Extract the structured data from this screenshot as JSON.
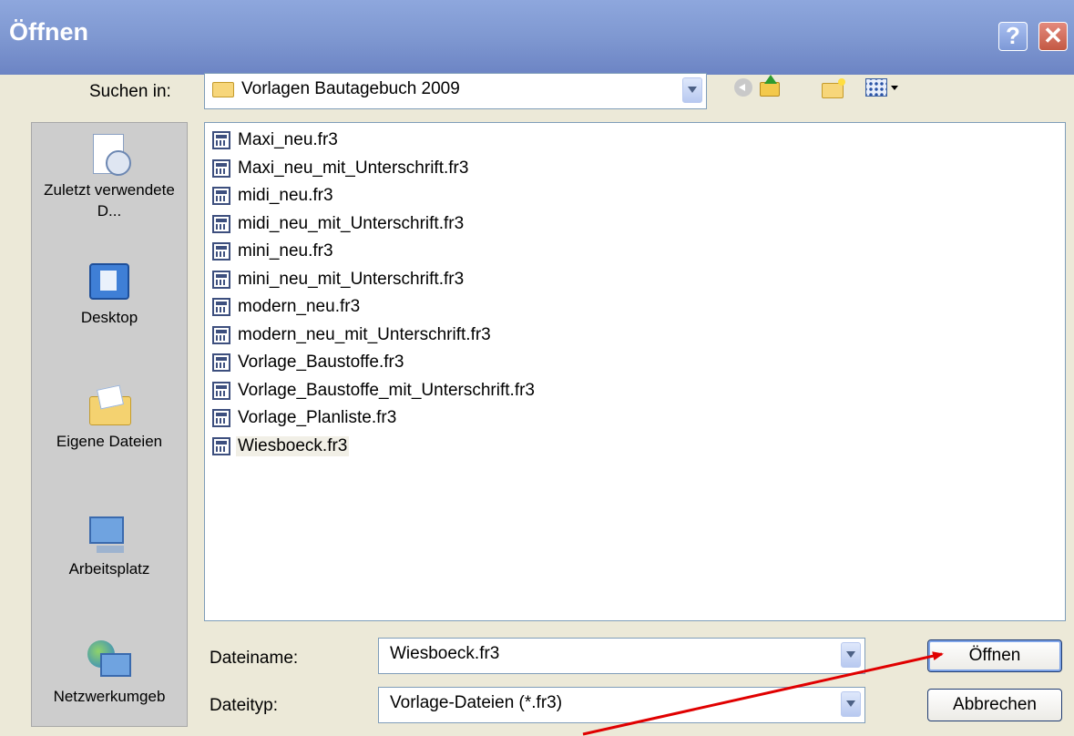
{
  "window": {
    "title": "Öffnen",
    "help_glyph": "?",
    "close_glyph": "✕"
  },
  "lookin": {
    "label": "Suchen in:",
    "value": "Vorlagen Bautagebuch 2009"
  },
  "toolbar": {
    "icons": [
      "back-icon",
      "up-folder-icon",
      "new-folder-icon",
      "view-menu-icon"
    ]
  },
  "places": [
    {
      "label": "Zuletzt verwendete D...",
      "icon": "recent-documents-icon"
    },
    {
      "label": "Desktop",
      "icon": "desktop-icon"
    },
    {
      "label": "Eigene Dateien",
      "icon": "my-documents-icon"
    },
    {
      "label": "Arbeitsplatz",
      "icon": "my-computer-icon"
    },
    {
      "label": "Netzwerkumgeb",
      "icon": "network-icon"
    }
  ],
  "files": [
    "Maxi_neu.fr3",
    "Maxi_neu_mit_Unterschrift.fr3",
    "midi_neu.fr3",
    "midi_neu_mit_Unterschrift.fr3",
    "mini_neu.fr3",
    "mini_neu_mit_Unterschrift.fr3",
    "modern_neu.fr3",
    "modern_neu_mit_Unterschrift.fr3",
    "Vorlage_Baustoffe.fr3",
    "Vorlage_Baustoffe_mit_Unterschrift.fr3",
    "Vorlage_Planliste.fr3",
    "Wiesboeck.fr3"
  ],
  "selected_file": "Wiesboeck.fr3",
  "filename": {
    "label": "Dateiname:",
    "value": "Wiesboeck.fr3"
  },
  "filetype": {
    "label": "Dateityp:",
    "value": "Vorlage-Dateien (*.fr3)"
  },
  "buttons": {
    "open": "Öffnen",
    "cancel": "Abbrechen"
  },
  "colors": {
    "annotation_arrow": "#e00000",
    "titlebar": "#7f98d1"
  }
}
